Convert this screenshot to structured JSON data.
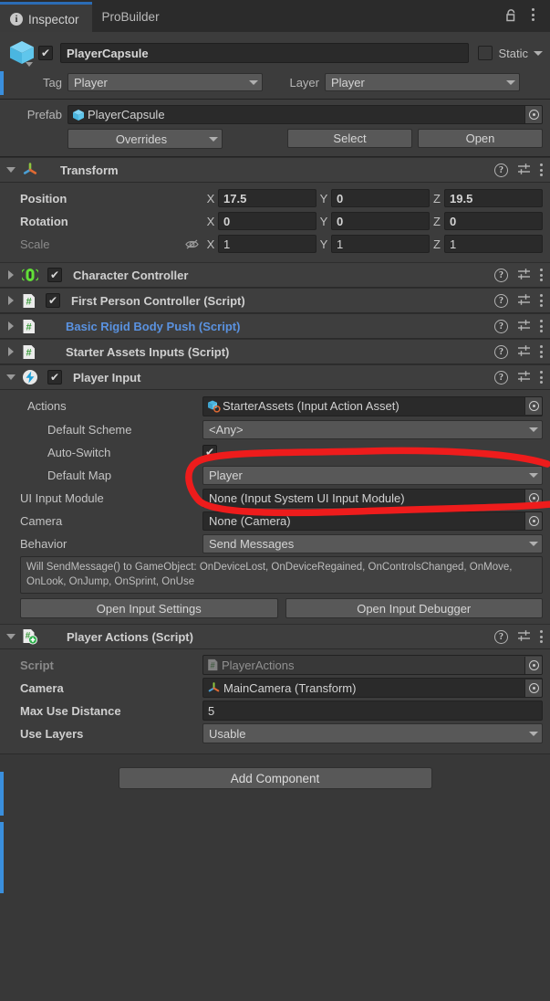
{
  "window": {
    "tabs": [
      {
        "label": "Inspector",
        "icon": "info-icon",
        "active": true
      },
      {
        "label": "ProBuilder",
        "icon": null,
        "active": false
      }
    ],
    "lock_icon": "padlock-unlocked-icon",
    "menu_icon": "kebab-menu-icon"
  },
  "gameobject": {
    "icon": "prefab-cube-icon",
    "enabled_checkmark": "✔",
    "name": "PlayerCapsule",
    "static_label": "Static",
    "static_checked": false,
    "tag_label": "Tag",
    "tag_value": "Player",
    "layer_label": "Layer",
    "layer_value": "Player"
  },
  "prefab": {
    "label": "Prefab",
    "value": "PlayerCapsule",
    "icon": "prefab-cube-icon",
    "overrides_label": "Overrides",
    "select_label": "Select",
    "open_label": "Open"
  },
  "components": [
    {
      "id": "transform",
      "title": "Transform",
      "icon": "transform-axis-icon",
      "expanded": true,
      "has_checkbox": false,
      "rows": [
        {
          "label": "Position",
          "axes": [
            {
              "axis": "X",
              "value": "17.5"
            },
            {
              "axis": "Y",
              "value": "0"
            },
            {
              "axis": "Z",
              "value": "19.5"
            }
          ]
        },
        {
          "label": "Rotation",
          "axes": [
            {
              "axis": "X",
              "value": "0"
            },
            {
              "axis": "Y",
              "value": "0"
            },
            {
              "axis": "Z",
              "value": "0"
            }
          ]
        },
        {
          "label": "Scale",
          "dim": true,
          "link_icon": "constrain-proportions-off-icon",
          "axes": [
            {
              "axis": "X",
              "value": "1"
            },
            {
              "axis": "Y",
              "value": "1"
            },
            {
              "axis": "Z",
              "value": "1"
            }
          ]
        }
      ]
    },
    {
      "id": "character-controller",
      "title": "Character Controller",
      "icon": "character-controller-capsule-icon",
      "expanded": false,
      "has_checkbox": true,
      "checked": true,
      "link": false
    },
    {
      "id": "first-person-controller",
      "title": "First Person Controller (Script)",
      "icon": "cs-script-icon",
      "expanded": false,
      "has_checkbox": true,
      "checked": true,
      "link": false
    },
    {
      "id": "basic-rigid-body-push",
      "title": "Basic Rigid Body Push (Script)",
      "icon": "cs-script-icon",
      "expanded": false,
      "has_checkbox": false,
      "link": true
    },
    {
      "id": "starter-assets-inputs",
      "title": "Starter Assets Inputs (Script)",
      "icon": "cs-script-icon",
      "expanded": false,
      "has_checkbox": false,
      "link": false
    }
  ],
  "player_input": {
    "title": "Player Input",
    "icon": "input-lightning-icon",
    "checked": true,
    "fields": {
      "actions_label": "Actions",
      "actions_value": "StarterAssets (Input Action Asset)",
      "actions_icon": "input-action-asset-icon",
      "default_scheme_label": "Default Scheme",
      "default_scheme_value": "<Any>",
      "auto_switch_label": "Auto-Switch",
      "auto_switch_checked": true,
      "default_map_label": "Default Map",
      "default_map_value": "Player",
      "ui_input_module_label": "UI Input Module",
      "ui_input_module_value": "None (Input System UI Input Module)",
      "camera_label": "Camera",
      "camera_value": "None (Camera)",
      "behavior_label": "Behavior",
      "behavior_value": "Send Messages"
    },
    "helpbox": "Will SendMessage() to GameObject: OnDeviceLost, OnDeviceRegained, OnControlsChanged, OnMove, OnLook, OnJump, OnSprint, OnUse",
    "open_input_settings": "Open Input Settings",
    "open_input_debugger": "Open Input Debugger"
  },
  "player_actions": {
    "title": "Player Actions (Script)",
    "icon": "script-add-icon",
    "fields": {
      "script_label": "Script",
      "script_value": "PlayerActions",
      "script_icon": "cs-script-icon",
      "camera_label": "Camera",
      "camera_value": "MainCamera (Transform)",
      "camera_icon": "transform-axis-icon",
      "max_use_distance_label": "Max Use Distance",
      "max_use_distance_value": "5",
      "use_layers_label": "Use Layers",
      "use_layers_value": "Usable"
    }
  },
  "footer": {
    "add_component_label": "Add Component"
  },
  "annotation": {
    "type": "hand-drawn-ellipse",
    "color": "#ee1c1c",
    "targets": "actions-object-field"
  },
  "colors": {
    "accent_blue": "#2b6cb5",
    "prefab_override_blue": "#3a8fdd",
    "script_link_blue": "#5a92e0",
    "panel_bg": "#3c3c3c",
    "window_bg": "#383838",
    "annotation_red": "#ee1c1c"
  }
}
